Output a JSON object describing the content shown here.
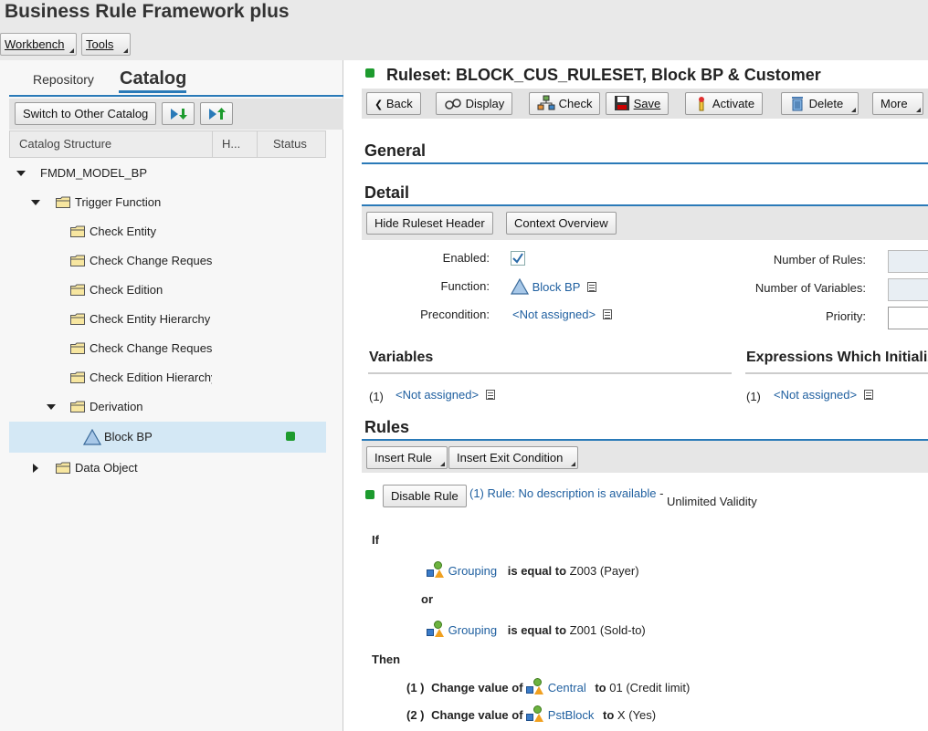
{
  "app": {
    "title": "Business Rule Framework plus"
  },
  "menu": {
    "workbench": "Workbench",
    "tools": "Tools"
  },
  "left": {
    "tabs": {
      "repository": "Repository",
      "catalog": "Catalog"
    },
    "toolbar": {
      "switch_catalog": "Switch to Other Catalog"
    },
    "columns": {
      "structure": "Catalog Structure",
      "h": "H...",
      "status": "Status"
    },
    "tree": [
      {
        "label": "FMDM_MODEL_BP"
      },
      {
        "label": "Trigger Function"
      },
      {
        "label": "Check Entity"
      },
      {
        "label": "Check Change Request"
      },
      {
        "label": "Check Edition"
      },
      {
        "label": "Check Entity Hierarchy"
      },
      {
        "label": "Check Change Request"
      },
      {
        "label": "Check Edition Hierarchy"
      },
      {
        "label": "Derivation"
      },
      {
        "label": "Block BP"
      },
      {
        "label": "Data Object"
      }
    ]
  },
  "right": {
    "title": "Ruleset: BLOCK_CUS_RULESET, Block BP & Customer",
    "toolbar": {
      "back": "Back",
      "display": "Display",
      "check": "Check",
      "save": "Save",
      "activate": "Activate",
      "delete": "Delete",
      "more": "More"
    },
    "general": {
      "title": "General"
    },
    "detail": {
      "title": "Detail",
      "hide_header": "Hide Ruleset Header",
      "context_overview": "Context Overview",
      "enabled_label": "Enabled:",
      "function_label": "Function:",
      "function_value": "Block BP",
      "precondition_label": "Precondition:",
      "precondition_value": "<Not assigned>",
      "num_rules_label": "Number of Rules:",
      "num_vars_label": "Number of Variables:",
      "priority_label": "Priority:"
    },
    "variables": {
      "title": "Variables",
      "index": "(1)",
      "value": "<Not assigned>"
    },
    "expressions": {
      "title": "Expressions Which Initializ",
      "index": "(1)",
      "value": "<Not assigned>"
    },
    "rules": {
      "title": "Rules",
      "insert_rule": "Insert Rule",
      "insert_exit": "Insert Exit Condition",
      "disable_rule": "Disable Rule",
      "rule_link": "(1) Rule: No description is available",
      "rule_dash": "-",
      "validity": "Unlimited Validity",
      "if": "If",
      "cond1": {
        "field": "Grouping",
        "op": "is equal to",
        "value": "Z003 (Payer)"
      },
      "or": "or",
      "cond2": {
        "field": "Grouping",
        "op": "is equal to",
        "value": "Z001 (Sold-to)"
      },
      "then": "Then",
      "action1": {
        "index": "(1 )",
        "text": "Change value of",
        "field": "Central",
        "to": "to",
        "value": "01 (Credit limit)"
      },
      "action2": {
        "index": "(2 )",
        "text": "Change value of",
        "field": "PstBlock",
        "to": "to",
        "value": "X (Yes)"
      }
    }
  },
  "colors": {
    "accent": "#2a7ab8",
    "status_green": "#1d9b2e",
    "selection": "#d4e8f5",
    "link": "#2060a0"
  }
}
